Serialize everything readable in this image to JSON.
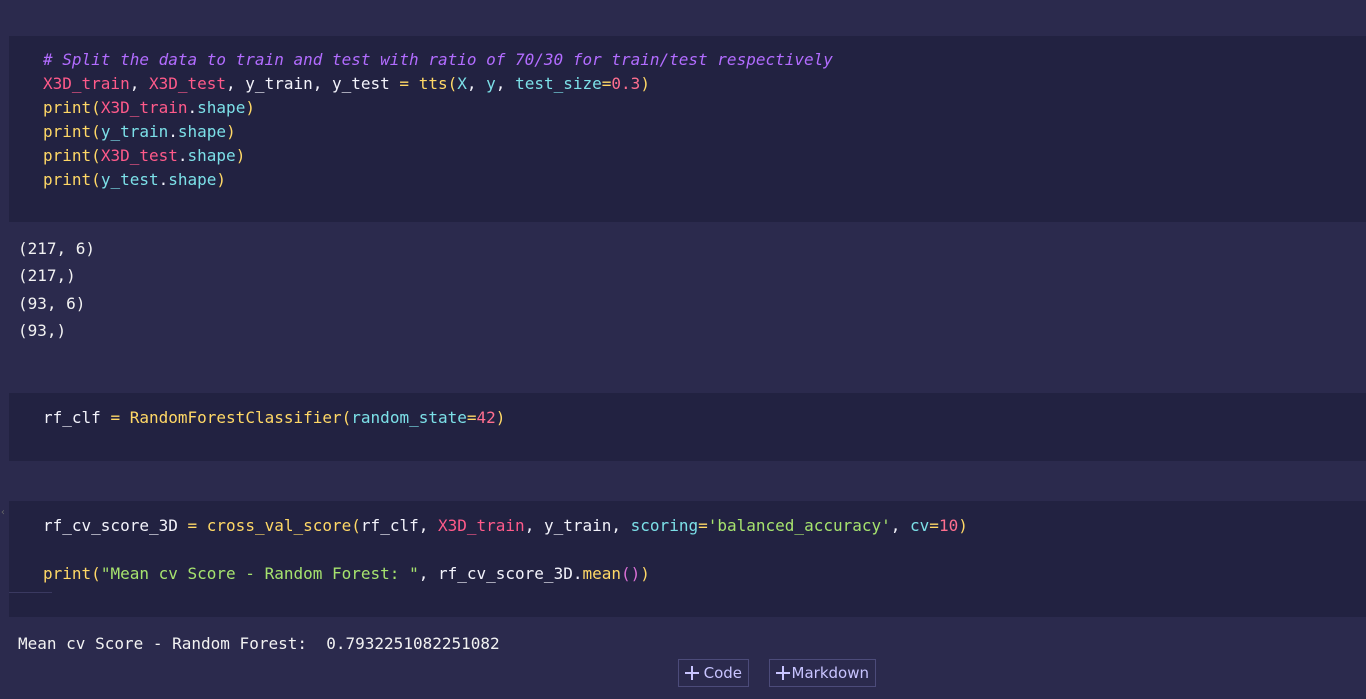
{
  "cells": {
    "split": {
      "lines": [
        [
          {
            "t": "# Split the data to train and test with ratio of 70/30 for train/test respectively",
            "c": "comment"
          }
        ],
        [
          {
            "t": "X3D_train",
            "c": "var-red"
          },
          {
            "t": ", ",
            "c": "plain"
          },
          {
            "t": "X3D_test",
            "c": "var-red"
          },
          {
            "t": ", y_train, y_test ",
            "c": "plain"
          },
          {
            "t": "=",
            "c": "op"
          },
          {
            "t": " ",
            "c": "plain"
          },
          {
            "t": "tts",
            "c": "func"
          },
          {
            "t": "(",
            "c": "paren"
          },
          {
            "t": "X",
            "c": "attr"
          },
          {
            "t": ", ",
            "c": "plain"
          },
          {
            "t": "y",
            "c": "attr"
          },
          {
            "t": ", ",
            "c": "plain"
          },
          {
            "t": "test_size",
            "c": "param"
          },
          {
            "t": "=",
            "c": "op"
          },
          {
            "t": "0.3",
            "c": "num"
          },
          {
            "t": ")",
            "c": "paren"
          }
        ],
        [
          {
            "t": "print",
            "c": "func"
          },
          {
            "t": "(",
            "c": "paren"
          },
          {
            "t": "X3D_train",
            "c": "var-red"
          },
          {
            "t": ".",
            "c": "plain"
          },
          {
            "t": "shape",
            "c": "attr"
          },
          {
            "t": ")",
            "c": "paren"
          }
        ],
        [
          {
            "t": "print",
            "c": "func"
          },
          {
            "t": "(",
            "c": "paren"
          },
          {
            "t": "y_train",
            "c": "attr"
          },
          {
            "t": ".",
            "c": "plain"
          },
          {
            "t": "shape",
            "c": "attr"
          },
          {
            "t": ")",
            "c": "paren"
          }
        ],
        [
          {
            "t": "print",
            "c": "func"
          },
          {
            "t": "(",
            "c": "paren"
          },
          {
            "t": "X3D_test",
            "c": "var-red"
          },
          {
            "t": ".",
            "c": "plain"
          },
          {
            "t": "shape",
            "c": "attr"
          },
          {
            "t": ")",
            "c": "paren"
          }
        ],
        [
          {
            "t": "print",
            "c": "func"
          },
          {
            "t": "(",
            "c": "paren"
          },
          {
            "t": "y_test",
            "c": "attr"
          },
          {
            "t": ".",
            "c": "plain"
          },
          {
            "t": "shape",
            "c": "attr"
          },
          {
            "t": ")",
            "c": "paren"
          }
        ]
      ],
      "output": [
        "(217, 6)",
        "(217,)",
        "(93, 6)",
        "(93,)"
      ]
    },
    "clf": {
      "lines": [
        [
          {
            "t": "rf_clf ",
            "c": "plain"
          },
          {
            "t": "=",
            "c": "op"
          },
          {
            "t": " ",
            "c": "plain"
          },
          {
            "t": "RandomForestClassifier",
            "c": "cls"
          },
          {
            "t": "(",
            "c": "paren"
          },
          {
            "t": "random_state",
            "c": "param"
          },
          {
            "t": "=",
            "c": "op"
          },
          {
            "t": "42",
            "c": "num"
          },
          {
            "t": ")",
            "c": "paren"
          }
        ]
      ]
    },
    "cv": {
      "lines": [
        [
          {
            "t": "rf_cv_score_3D ",
            "c": "plain"
          },
          {
            "t": "=",
            "c": "op"
          },
          {
            "t": " ",
            "c": "plain"
          },
          {
            "t": "cross_val_score",
            "c": "func"
          },
          {
            "t": "(",
            "c": "paren"
          },
          {
            "t": "rf_clf, ",
            "c": "plain"
          },
          {
            "t": "X3D_train",
            "c": "var-red"
          },
          {
            "t": ", y_train, ",
            "c": "plain"
          },
          {
            "t": "scoring",
            "c": "param"
          },
          {
            "t": "=",
            "c": "op"
          },
          {
            "t": "'balanced_accuracy'",
            "c": "str"
          },
          {
            "t": ", ",
            "c": "plain"
          },
          {
            "t": "cv",
            "c": "param"
          },
          {
            "t": "=",
            "c": "op"
          },
          {
            "t": "10",
            "c": "num"
          },
          {
            "t": ")",
            "c": "paren"
          }
        ],
        [],
        [
          {
            "t": "print",
            "c": "func"
          },
          {
            "t": "(",
            "c": "paren"
          },
          {
            "t": "\"Mean cv Score - Random Forest: \"",
            "c": "str"
          },
          {
            "t": ", rf_cv_score_3D.",
            "c": "plain"
          },
          {
            "t": "mean",
            "c": "func"
          },
          {
            "t": "()",
            "c": "paren2"
          },
          {
            "t": ")",
            "c": "paren"
          }
        ]
      ],
      "output": [
        "Mean cv Score - Random Forest:  0.7932251082251082"
      ]
    }
  },
  "toolbar": {
    "code_label": "Code",
    "markdown_label": "Markdown"
  },
  "colors": {
    "background": "#2b2a4d",
    "cell_background": "#222241",
    "comment": "#b26cff",
    "string": "#a6e36e",
    "number": "#ff6f8f"
  }
}
